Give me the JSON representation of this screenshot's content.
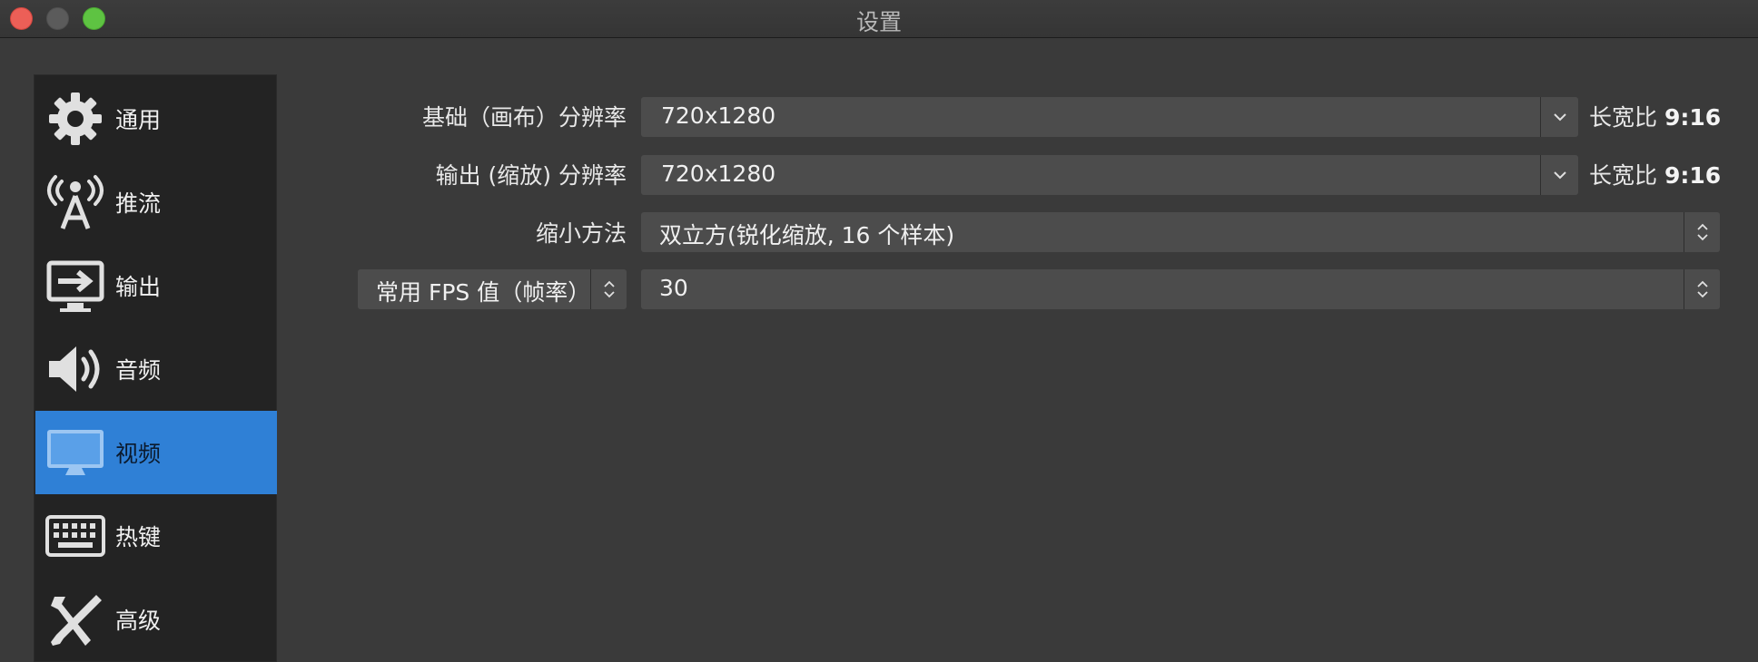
{
  "window": {
    "title": "设置"
  },
  "sidebar": {
    "items": [
      {
        "label": "通用",
        "icon": "gear-icon"
      },
      {
        "label": "推流",
        "icon": "antenna-icon"
      },
      {
        "label": "输出",
        "icon": "monitor-export-icon"
      },
      {
        "label": "音频",
        "icon": "speaker-icon"
      },
      {
        "label": "视频",
        "icon": "monitor-icon",
        "active": true
      },
      {
        "label": "热键",
        "icon": "keyboard-icon"
      },
      {
        "label": "高级",
        "icon": "tools-icon"
      }
    ]
  },
  "video": {
    "base_resolution": {
      "label": "基础（画布）分辨率",
      "value": "720x1280",
      "aspect_prefix": "长宽比",
      "aspect_value": "9:16"
    },
    "output_resolution": {
      "label": "输出 (缩放) 分辨率",
      "value": "720x1280",
      "aspect_prefix": "长宽比",
      "aspect_value": "9:16"
    },
    "downscale_filter": {
      "label": "缩小方法",
      "value": "双立方(锐化缩放, 16 个样本)"
    },
    "fps": {
      "type_label": "常用 FPS 值（帧率）",
      "value": "30"
    }
  },
  "colors": {
    "accent": "#2f80d6",
    "background": "#3a3a3a",
    "sidebar": "#232323",
    "field": "#4c4c4c"
  }
}
